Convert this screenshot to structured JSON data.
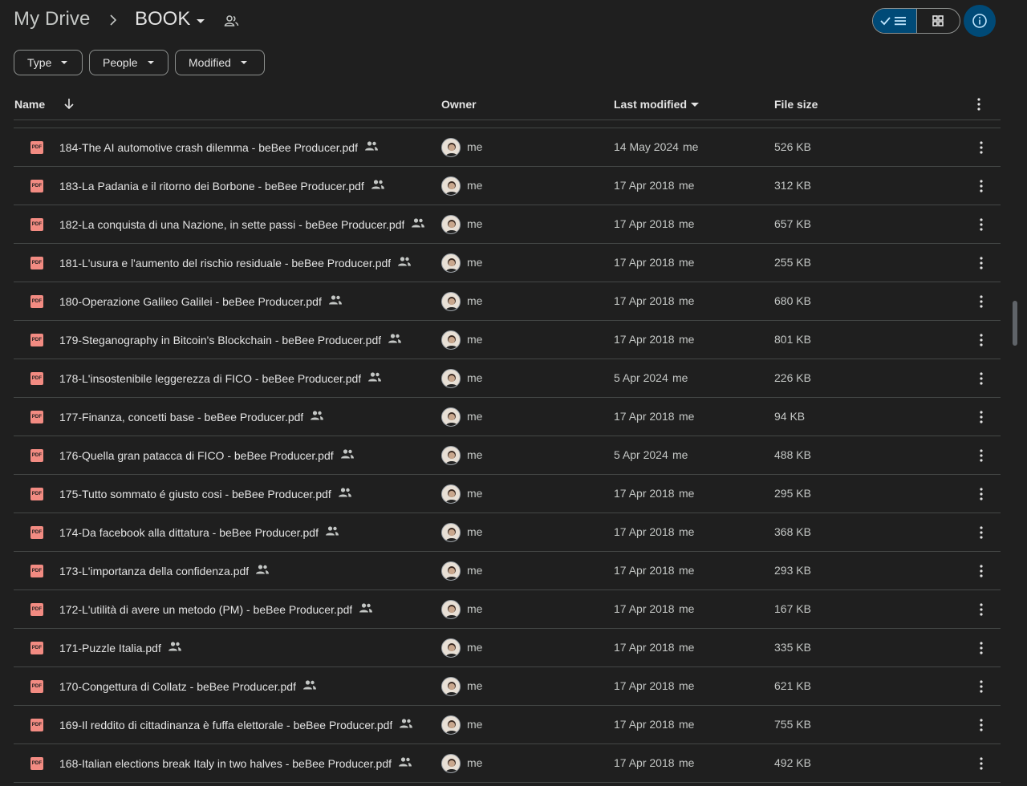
{
  "breadcrumb": {
    "root": "My Drive",
    "current": "BOOK"
  },
  "filters": {
    "type": "Type",
    "people": "People",
    "modified": "Modified"
  },
  "columns": {
    "name": "Name",
    "owner": "Owner",
    "modified": "Last modified",
    "size": "File size"
  },
  "colors": {
    "pdf": "#f28b82",
    "accent": "#004a77"
  },
  "files": [
    {
      "name": "184-The AI automotive crash dilemma - beBee Producer.pdf",
      "owner": "me",
      "date": "14 May 2024",
      "by": "me",
      "size": "526 KB"
    },
    {
      "name": "183-La Padania e il ritorno dei Borbone - beBee Producer.pdf",
      "owner": "me",
      "date": "17 Apr 2018",
      "by": "me",
      "size": "312 KB"
    },
    {
      "name": "182-La conquista di una Nazione, in sette passi - beBee Producer.pdf",
      "owner": "me",
      "date": "17 Apr 2018",
      "by": "me",
      "size": "657 KB"
    },
    {
      "name": "181-L'usura e l'aumento del rischio residuale - beBee Producer.pdf",
      "owner": "me",
      "date": "17 Apr 2018",
      "by": "me",
      "size": "255 KB"
    },
    {
      "name": "180-Operazione Galileo Galilei - beBee Producer.pdf",
      "owner": "me",
      "date": "17 Apr 2018",
      "by": "me",
      "size": "680 KB"
    },
    {
      "name": "179-Steganography in Bitcoin's Blockchain - beBee Producer.pdf",
      "owner": "me",
      "date": "17 Apr 2018",
      "by": "me",
      "size": "801 KB"
    },
    {
      "name": "178-L'insostenibile leggerezza di FICO - beBee Producer.pdf",
      "owner": "me",
      "date": "5 Apr 2024",
      "by": "me",
      "size": "226 KB"
    },
    {
      "name": "177-Finanza, concetti base - beBee Producer.pdf",
      "owner": "me",
      "date": "17 Apr 2018",
      "by": "me",
      "size": "94 KB"
    },
    {
      "name": "176-Quella gran patacca di FICO - beBee Producer.pdf",
      "owner": "me",
      "date": "5 Apr 2024",
      "by": "me",
      "size": "488 KB"
    },
    {
      "name": "175-Tutto sommato é giusto cosi - beBee Producer.pdf",
      "owner": "me",
      "date": "17 Apr 2018",
      "by": "me",
      "size": "295 KB"
    },
    {
      "name": "174-Da facebook alla dittatura - beBee Producer.pdf",
      "owner": "me",
      "date": "17 Apr 2018",
      "by": "me",
      "size": "368 KB"
    },
    {
      "name": "173-L'importanza della confidenza.pdf",
      "owner": "me",
      "date": "17 Apr 2018",
      "by": "me",
      "size": "293 KB"
    },
    {
      "name": "172-L'utilità di avere un metodo (PM) - beBee Producer.pdf",
      "owner": "me",
      "date": "17 Apr 2018",
      "by": "me",
      "size": "167 KB"
    },
    {
      "name": "171-Puzzle Italia.pdf",
      "owner": "me",
      "date": "17 Apr 2018",
      "by": "me",
      "size": "335 KB"
    },
    {
      "name": "170-Congettura di Collatz - beBee Producer.pdf",
      "owner": "me",
      "date": "17 Apr 2018",
      "by": "me",
      "size": "621 KB"
    },
    {
      "name": "169-Il reddito di cittadinanza è fuffa elettorale - beBee Producer.pdf",
      "owner": "me",
      "date": "17 Apr 2018",
      "by": "me",
      "size": "755 KB"
    },
    {
      "name": "168-Italian elections break Italy in two halves - beBee Producer.pdf",
      "owner": "me",
      "date": "17 Apr 2018",
      "by": "me",
      "size": "492 KB"
    }
  ]
}
